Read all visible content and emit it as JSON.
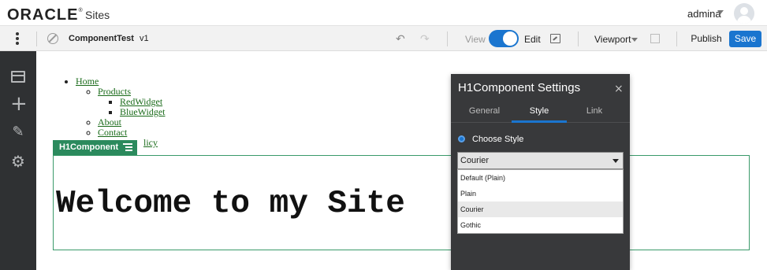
{
  "header": {
    "brand": "ORACLE",
    "brand_mark": "®",
    "product": "Sites",
    "user": "admina"
  },
  "toolbar": {
    "site_name": "ComponentTest",
    "version": "v1",
    "view_label": "View",
    "edit_label": "Edit",
    "viewport_label": "Viewport",
    "publish_label": "Publish",
    "save_label": "Save",
    "edit_mode_on": true
  },
  "colors": {
    "accent": "#1a75cf",
    "component_green": "#2b8a5d",
    "panel_bg": "#38393b",
    "rail_bg": "#2f3133"
  },
  "nav_menu": {
    "home": "Home",
    "products": "Products",
    "red_widget": "RedWidget",
    "blue_widget": "BlueWidget",
    "about": "About",
    "contact": "Contact",
    "privacy_fragment": "licy"
  },
  "component": {
    "tab_label": "H1Component",
    "heading": "Welcome to my Site"
  },
  "settings_panel": {
    "title": "H1Component Settings",
    "close_glyph": "×",
    "tabs": [
      "General",
      "Style",
      "Link"
    ],
    "active_tab": "Style",
    "choose_style_label": "Choose Style",
    "selected_style": "Courier",
    "options": [
      "Default (Plain)",
      "Plain",
      "Courier",
      "Gothic"
    ]
  }
}
